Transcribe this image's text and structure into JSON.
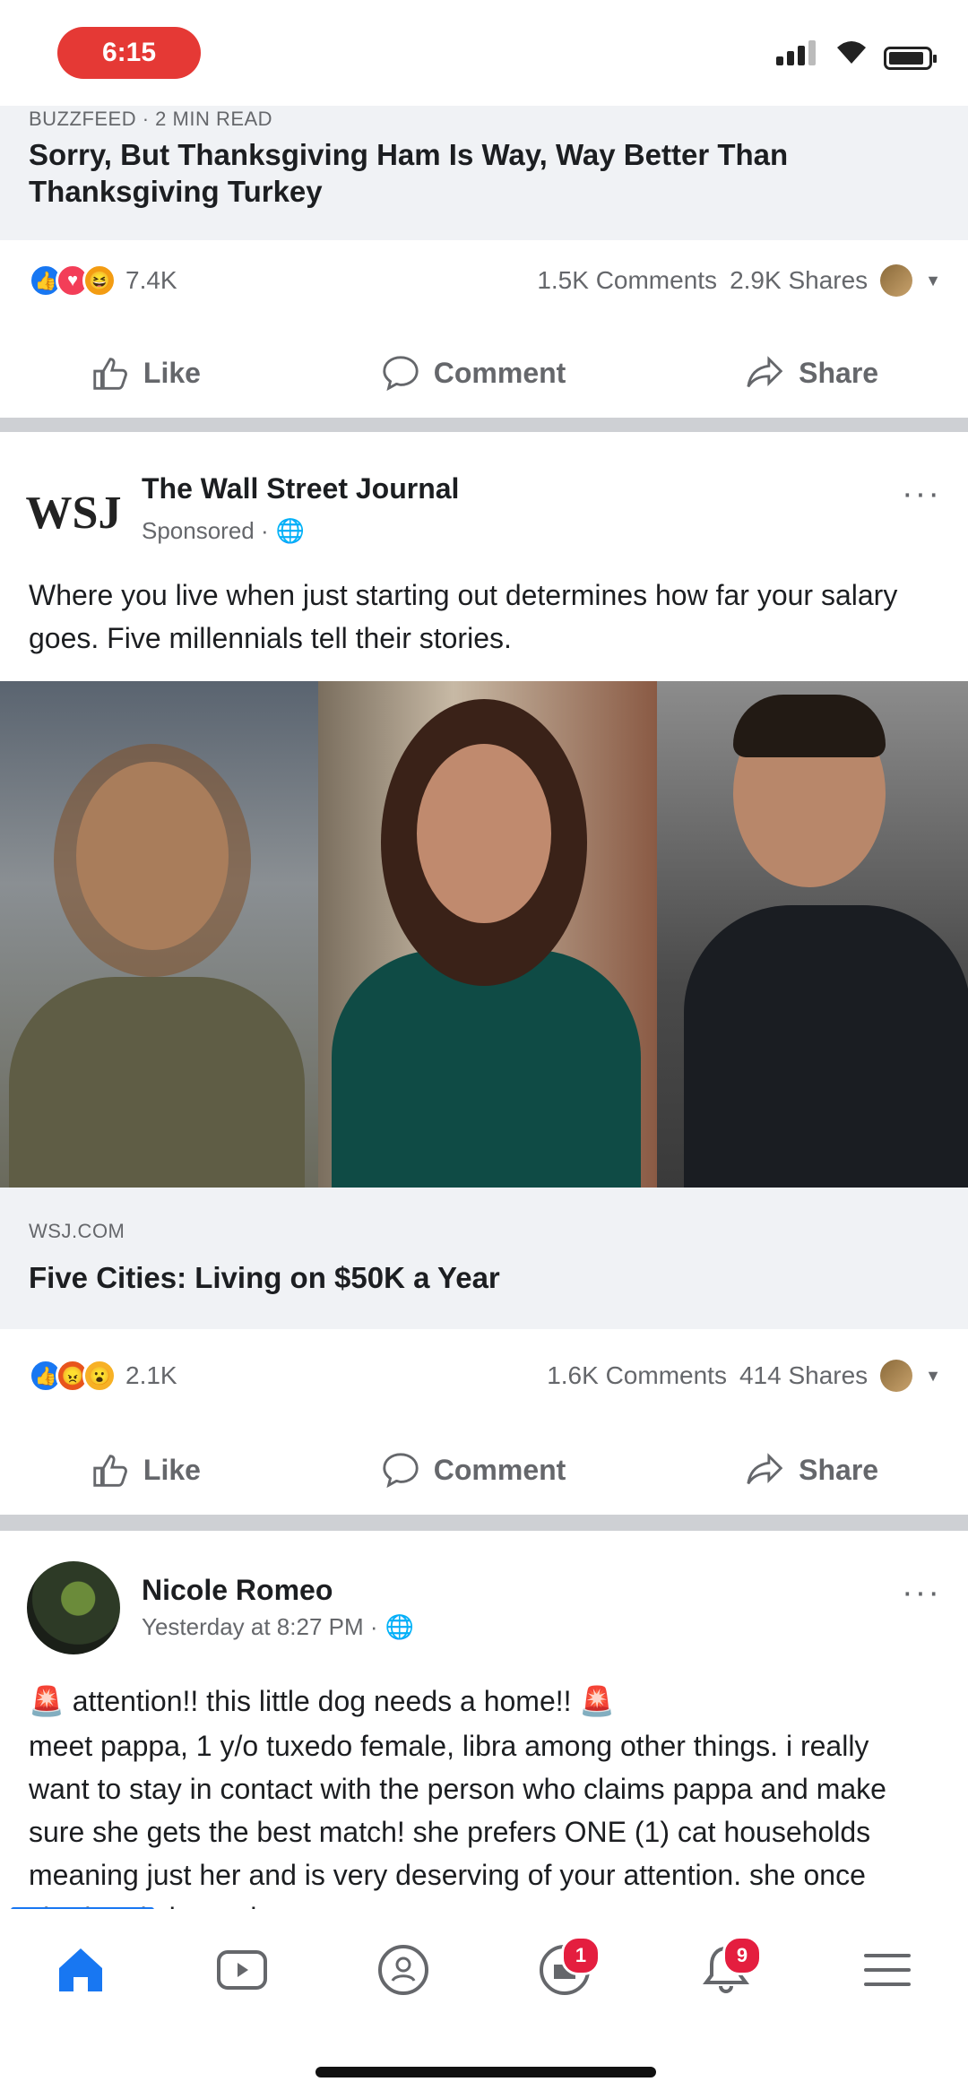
{
  "status_bar": {
    "time": "6:15"
  },
  "top_post": {
    "link": {
      "source": "BUZZFEED · 2 MIN READ",
      "title": "Sorry, But Thanksgiving Ham Is Way, Way Better Than Thanksgiving Turkey"
    },
    "stats": {
      "reactions_count": "7.4K",
      "comments": "1.5K Comments",
      "shares": "2.9K Shares"
    }
  },
  "actions": {
    "like": "Like",
    "comment": "Comment",
    "share": "Share"
  },
  "wsj_post": {
    "author": "The Wall Street Journal",
    "avatar_text": "WSJ",
    "meta": "Sponsored ·",
    "text": "Where you live when just starting out determines how far your salary goes. Five millennials tell their stories.",
    "link": {
      "source": "WSJ.COM",
      "title": "Five Cities: Living on $50K a Year"
    },
    "stats": {
      "reactions_count": "2.1K",
      "comments": "1.6K Comments",
      "shares": "414 Shares"
    }
  },
  "nicole_post": {
    "author": "Nicole Romeo",
    "meta": "Yesterday at 8:27 PM ·",
    "text_line1": "attention!! this little dog needs a home!!",
    "text_rest": "meet pappa, 1 y/o tuxedo female, libra among other things. i really want to stay in contact with the person who claims pappa and make sure she gets the best match! she prefers ONE (1) cat households meaning just her and is very deserving of your attention. she once shed and she and"
  },
  "bottom_nav": {
    "items": [
      {
        "name": "home",
        "icon": "home-icon",
        "badge": ""
      },
      {
        "name": "watch",
        "icon": "watch-icon",
        "badge": ""
      },
      {
        "name": "groups",
        "icon": "groups-icon",
        "badge": ""
      },
      {
        "name": "marketplace",
        "icon": "marketplace-icon",
        "badge": "1"
      },
      {
        "name": "notifications",
        "icon": "bell-icon",
        "badge": "9"
      },
      {
        "name": "menu",
        "icon": "menu-icon",
        "badge": ""
      }
    ]
  },
  "colors": {
    "accent": "#1877f2",
    "badge": "#e41e3f",
    "status_pill": "#e53935"
  }
}
